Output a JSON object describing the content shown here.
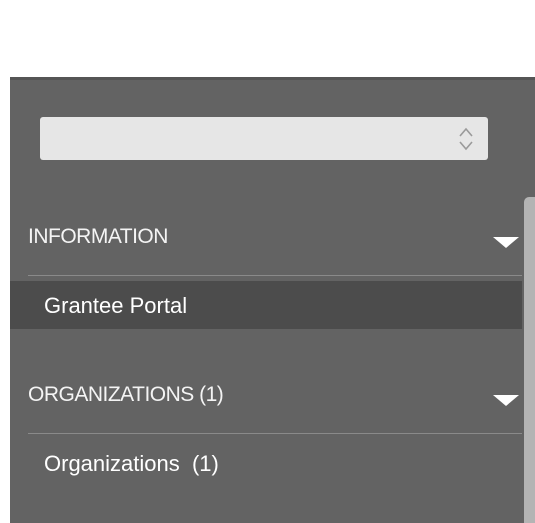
{
  "selector": {
    "value": ""
  },
  "sections": [
    {
      "header": "INFORMATION",
      "items": [
        {
          "label": "Grantee Portal",
          "active": true
        }
      ]
    },
    {
      "header": "ORGANIZATIONS (1)",
      "items": [
        {
          "label": "Organizations  (1)",
          "active": false
        }
      ]
    }
  ],
  "colors": {
    "panel_background": "#636363",
    "active_item_background": "#4c4c4c",
    "select_background": "#e6e6e6",
    "scrollbar": "#b4b4b4",
    "text": "#ffffff"
  },
  "icons": {
    "select_arrows": "up-down-chevron-icon",
    "section_toggle": "caret-down-icon"
  }
}
